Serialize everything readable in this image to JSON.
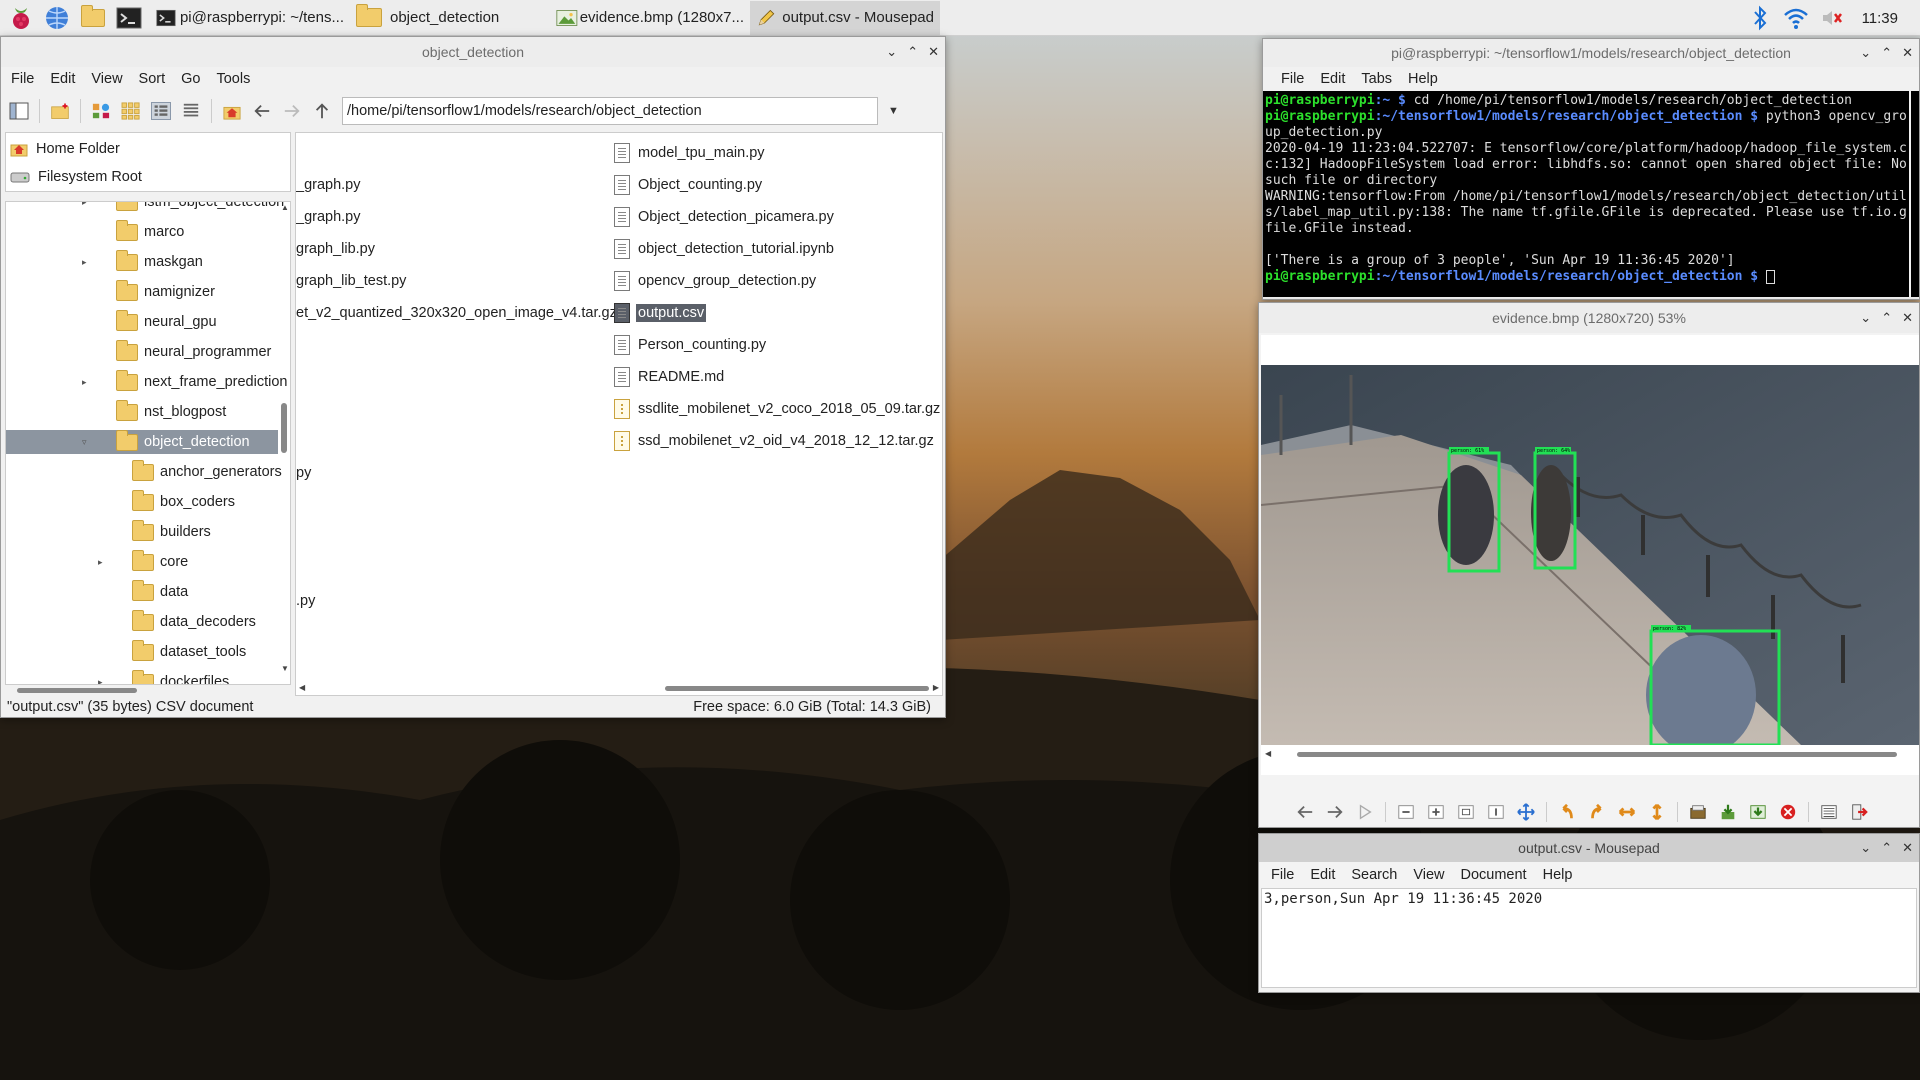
{
  "taskbar": {
    "tasks": [
      {
        "label": "pi@raspberrypi: ~/tens..."
      },
      {
        "label": "object_detection"
      },
      {
        "label": "evidence.bmp (1280x7..."
      },
      {
        "label": "output.csv - Mousepad"
      }
    ],
    "clock": "11:39"
  },
  "filemanager": {
    "title": "object_detection",
    "menu": [
      "File",
      "Edit",
      "View",
      "Sort",
      "Go",
      "Tools"
    ],
    "path": "/home/pi/tensorflow1/models/research/object_detection",
    "places": [
      "Home Folder",
      "Filesystem Root"
    ],
    "tree": [
      {
        "label": "lstm_object_detection",
        "indent": 1,
        "expander": true
      },
      {
        "label": "marco",
        "indent": 1,
        "expander": false
      },
      {
        "label": "maskgan",
        "indent": 1,
        "expander": true
      },
      {
        "label": "namignizer",
        "indent": 1,
        "expander": false
      },
      {
        "label": "neural_gpu",
        "indent": 1,
        "expander": false
      },
      {
        "label": "neural_programmer",
        "indent": 1,
        "expander": false
      },
      {
        "label": "next_frame_prediction",
        "indent": 1,
        "expander": true
      },
      {
        "label": "nst_blogpost",
        "indent": 1,
        "expander": false
      },
      {
        "label": "object_detection",
        "indent": 1,
        "expander": true,
        "selected": true
      },
      {
        "label": "anchor_generators",
        "indent": 2,
        "expander": false
      },
      {
        "label": "box_coders",
        "indent": 2,
        "expander": false
      },
      {
        "label": "builders",
        "indent": 2,
        "expander": false
      },
      {
        "label": "core",
        "indent": 2,
        "expander": true
      },
      {
        "label": "data",
        "indent": 2,
        "expander": false
      },
      {
        "label": "data_decoders",
        "indent": 2,
        "expander": false
      },
      {
        "label": "dataset_tools",
        "indent": 2,
        "expander": false
      },
      {
        "label": "dockerfiles",
        "indent": 2,
        "expander": true
      }
    ],
    "files_left": [
      {
        "label": "_graph.py",
        "row": 2
      },
      {
        "label": "_graph.py",
        "row": 3
      },
      {
        "label": "graph_lib.py",
        "row": 4
      },
      {
        "label": "graph_lib_test.py",
        "row": 5
      },
      {
        "label": "et_v2_quantized_320x320_open_image_v4.tar.gz",
        "row": 6
      },
      {
        "label": "py",
        "row": 11
      },
      {
        "label": ".py",
        "row": 15
      }
    ],
    "files_right": [
      {
        "label": "model_tpu_main.py",
        "type": "text"
      },
      {
        "label": "Object_counting.py",
        "type": "text"
      },
      {
        "label": "Object_detection_picamera.py",
        "type": "text"
      },
      {
        "label": "object_detection_tutorial.ipynb",
        "type": "text"
      },
      {
        "label": "opencv_group_detection.py",
        "type": "text"
      },
      {
        "label": "output.csv",
        "type": "text",
        "selected": true
      },
      {
        "label": "Person_counting.py",
        "type": "text"
      },
      {
        "label": "README.md",
        "type": "text"
      },
      {
        "label": "ssdlite_mobilenet_v2_coco_2018_05_09.tar.gz",
        "type": "archive"
      },
      {
        "label": "ssd_mobilenet_v2_oid_v4_2018_12_12.tar.gz",
        "type": "archive"
      }
    ],
    "status_left": "\"output.csv\" (35 bytes) CSV document",
    "status_right": "Free space: 6.0 GiB (Total: 14.3 GiB)"
  },
  "terminal": {
    "title": "pi@raspberrypi: ~/tensorflow1/models/research/object_detection",
    "menu": [
      "File",
      "Edit",
      "Tabs",
      "Help"
    ],
    "prompt_user": "pi@raspberrypi",
    "home_path": "~",
    "cmd1": "cd /home/pi/tensorflow1/models/research/object_detection",
    "work_path": "~/tensorflow1/models/research/object_detection",
    "cmd2": "python3 opencv_group_detection.py",
    "output1": "2020-04-19 11:23:04.522707: E tensorflow/core/platform/hadoop/hadoop_file_system.cc:132] HadoopFileSystem load error: libhdfs.so: cannot open shared object file: No such file or directory",
    "output2": "WARNING:tensorflow:From /home/pi/tensorflow1/models/research/object_detection/utils/label_map_util.py:138: The name tf.gfile.GFile is deprecated. Please use tf.io.gfile.GFile instead.",
    "output3": "['There is a group of 3 people', 'Sun Apr 19 11:36:45 2020']"
  },
  "imageviewer": {
    "title": "evidence.bmp (1280x720) 53%",
    "box_label_1": "person: 61%",
    "box_label_2": "person: 64%",
    "box_label_3": "person: 82%"
  },
  "mousepad": {
    "title": "output.csv - Mousepad",
    "menu": [
      "File",
      "Edit",
      "Search",
      "View",
      "Document",
      "Help"
    ],
    "content": "3,person,Sun Apr 19 11:36:45 2020"
  }
}
